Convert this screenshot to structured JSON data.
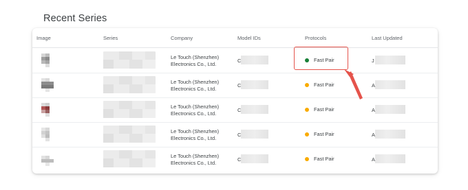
{
  "section": {
    "title": "Recent Series"
  },
  "table": {
    "columns": [
      "Image",
      "Series",
      "Company",
      "Model IDs",
      "Protocols",
      "Last Updated"
    ],
    "rows": [
      {
        "company_line1": "Le Touch (Shenzhen)",
        "company_line2": "Electronics Co., Ltd.",
        "model_prefix": "C",
        "protocol": "Fast Pair",
        "protocol_status_color": "#188038",
        "date_prefix": "J",
        "highlighted": true
      },
      {
        "company_line1": "Le Touch (Shenzhen)",
        "company_line2": "Electronics Co., Ltd.",
        "model_prefix": "C",
        "protocol": "Fast Pair",
        "protocol_status_color": "#f9ab00",
        "date_prefix": "A",
        "highlighted": false
      },
      {
        "company_line1": "Le Touch (Shenzhen)",
        "company_line2": "Electronics Co., Ltd.",
        "model_prefix": "C",
        "protocol": "Fast Pair",
        "protocol_status_color": "#f9ab00",
        "date_prefix": "A",
        "highlighted": false
      },
      {
        "company_line1": "Le Touch (Shenzhen)",
        "company_line2": "Electronics Co., Ltd.",
        "model_prefix": "C",
        "protocol": "Fast Pair",
        "protocol_status_color": "#f9ab00",
        "date_prefix": "A",
        "highlighted": false
      },
      {
        "company_line1": "Le Touch (Shenzhen)",
        "company_line2": "Electronics Co., Ltd.",
        "model_prefix": "C",
        "protocol": "Fast Pair",
        "protocol_status_color": "#f9ab00",
        "date_prefix": "A",
        "highlighted": false
      }
    ]
  },
  "annotation": {
    "color": "#e5534b",
    "icon": "arrow-pointer-icon"
  }
}
